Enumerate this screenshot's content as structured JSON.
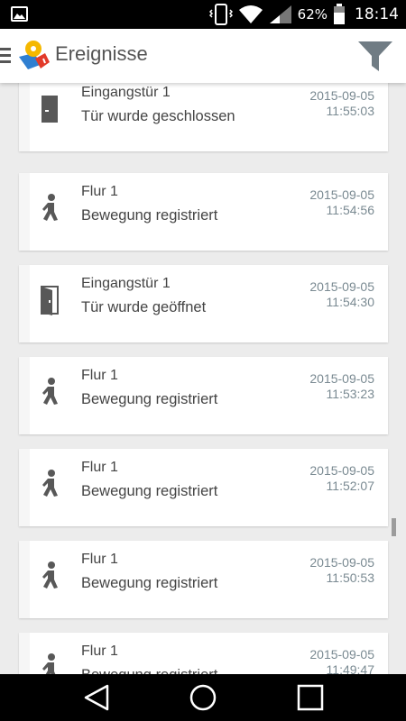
{
  "status_bar": {
    "battery_percent": "62%",
    "time": "18:14",
    "icons": [
      "gallery-icon",
      "vibrate-icon",
      "wifi-icon",
      "signal-icon",
      "battery-icon"
    ]
  },
  "app_bar": {
    "title": "Ereignisse",
    "icons": [
      "menu-icon",
      "app-logo",
      "filter-icon"
    ]
  },
  "colors": {
    "icon_gray": "#555555",
    "timestamp": "#7a8a92",
    "background": "#ececec"
  },
  "events": [
    {
      "icon": "door-closed-icon",
      "name": "Eingangstür 1",
      "message": "Tür wurde geschlossen",
      "date": "2015-09-05",
      "time": "11:55:03"
    },
    {
      "icon": "motion-icon",
      "name": "Flur 1",
      "message": "Bewegung registriert",
      "date": "2015-09-05",
      "time": "11:54:56"
    },
    {
      "icon": "door-open-icon",
      "name": "Eingangstür 1",
      "message": "Tür wurde geöffnet",
      "date": "2015-09-05",
      "time": "11:54:30"
    },
    {
      "icon": "motion-icon",
      "name": "Flur 1",
      "message": "Bewegung registriert",
      "date": "2015-09-05",
      "time": "11:53:23"
    },
    {
      "icon": "motion-icon",
      "name": "Flur 1",
      "message": "Bewegung registriert",
      "date": "2015-09-05",
      "time": "11:52:07"
    },
    {
      "icon": "motion-icon",
      "name": "Flur 1",
      "message": "Bewegung registriert",
      "date": "2015-09-05",
      "time": "11:50:53"
    },
    {
      "icon": "motion-icon",
      "name": "Flur 1",
      "message": "Bewegung registriert",
      "date": "2015-09-05",
      "time": "11:49:47"
    }
  ],
  "nav_bar": {
    "icons": [
      "back-icon",
      "home-icon",
      "recents-icon"
    ]
  }
}
